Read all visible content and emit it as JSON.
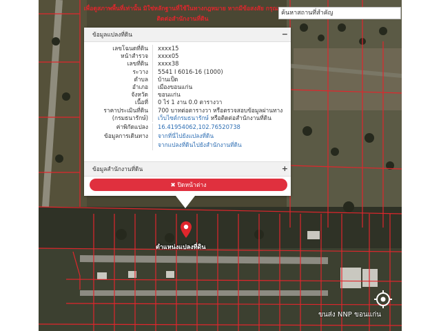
{
  "banner": {
    "text": "เพื่อดูสภาพพื้นที่เท่านั้น มิใช่หลักฐานที่ใช้ในทางกฎหมาย หากมีข้อสงสัย กรุณาติดต่อสำนักงานที่ดิน"
  },
  "search": {
    "placeholder": "ค้นหาสถานที่สำคัญ"
  },
  "popup": {
    "section1_title": "ข้อมูลแปลงที่ดิน",
    "section1_toggle": "−",
    "rows": [
      {
        "label": "เลขโฉนดที่ดิน",
        "value": "xxxx15"
      },
      {
        "label": "หน้าสำรวจ",
        "value": "xxxx05"
      },
      {
        "label": "เลขที่ดิน",
        "value": "xxxx38"
      },
      {
        "label": "ระวาง",
        "value": "5541 I 6016-16 (1000)"
      },
      {
        "label": "ตำบล",
        "value": "บ้านเป็ด"
      },
      {
        "label": "อำเภอ",
        "value": "เมืองขอนแก่น"
      },
      {
        "label": "จังหวัด",
        "value": "ขอนแก่น"
      },
      {
        "label": "เนื้อที่",
        "value": "0 ไร่ 1 งาน 0.0 ตารางวา"
      },
      {
        "label": "ราคาประเมินที่ดิน",
        "value": "700 บาทต่อตารางวา หรือตรวจสอบข้อมูลผ่านทาง"
      }
    ],
    "row_dept_label": "(กรมธนารักษ์)",
    "row_dept_link": "เว็บไซต์กรมธนารักษ์",
    "row_dept_suffix": " หรือติดต่อสำนักงานที่ดิน",
    "coord_label": "ค่าพิกัดแปลง",
    "coord_value": "16.41954062,102.76520738",
    "route_label": "ข้อมูลการเดินทาง",
    "route_link1": "จากที่นี่ไปยังแปลงที่ดิน",
    "route_link2": "จากแปลงที่ดินไปยังสำนักงานที่ดิน",
    "section2_title": "ข้อมูลสำนักงานที่ดิน",
    "section2_toggle": "+",
    "close_icon": "✖",
    "close_label": "ปิดหน้าต่าง"
  },
  "map": {
    "marker_label": "ตำแหน่งแปลงที่ดิน",
    "watermark": "ขนส่ง NNP ขอนแก่น",
    "marker_color": "#e0262c",
    "parcel_color": "#e0262c"
  }
}
